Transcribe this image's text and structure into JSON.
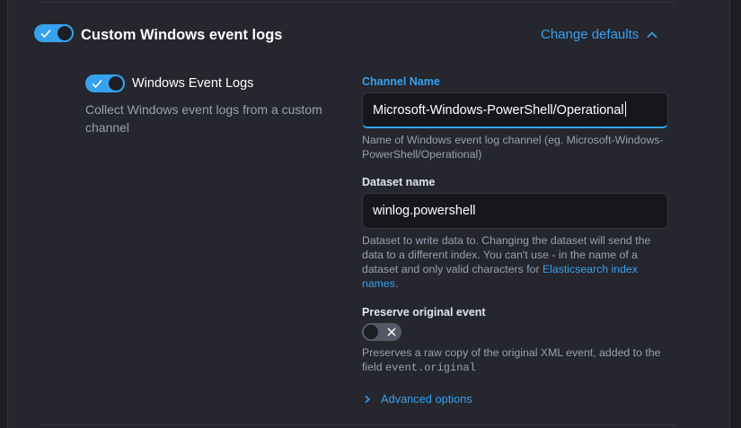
{
  "section": {
    "title": "Custom Windows event logs",
    "change_defaults": "Change defaults"
  },
  "input": {
    "title": "Windows Event Logs",
    "description": "Collect Windows event logs from a custom channel"
  },
  "fields": {
    "channel": {
      "label": "Channel Name",
      "value": "Microsoft-Windows-PowerShell/Operational",
      "help": "Name of Windows event log channel (eg. Microsoft-Windows-PowerShell/Operational)"
    },
    "dataset": {
      "label": "Dataset name",
      "value": "winlog.powershell",
      "help_before": "Dataset to write data to. Changing the dataset will send the data to a different index. You can't use - in the name of a dataset and only valid characters for ",
      "help_link": "Elasticsearch index names",
      "help_after": "."
    },
    "preserve": {
      "label": "Preserve original event",
      "help_before": "Preserves a raw copy of the original XML event, added to the field ",
      "help_code": "event.original"
    }
  },
  "advanced": {
    "label": "Advanced options"
  },
  "colors": {
    "accent": "#36a2ef",
    "background": "#25262e",
    "input_bg": "#16171c"
  }
}
